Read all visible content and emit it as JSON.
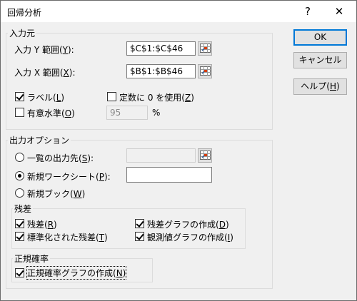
{
  "window": {
    "title": "回帰分析",
    "help_glyph": "?",
    "close_glyph": "✕"
  },
  "input_group": {
    "label": "入力元",
    "y_range_label_prefix": "入力 Y 範囲(",
    "y_range_key": "Y",
    "y_range_label_suffix": "):",
    "y_range_value": "$C$1:$C$46",
    "x_range_label_prefix": "入力 X 範囲(",
    "x_range_key": "X",
    "x_range_label_suffix": "):",
    "x_range_value": "$B$1:$B$46",
    "labels_prefix": "ラベル(",
    "labels_key": "L",
    "labels_suffix": ")",
    "labels_checked": true,
    "const_zero_prefix": "定数に 0 を使用(",
    "const_zero_key": "Z",
    "const_zero_suffix": ")",
    "const_zero_checked": false,
    "confidence_prefix": "有意水準(",
    "confidence_key": "O",
    "confidence_suffix": ")",
    "confidence_checked": false,
    "confidence_value": "95",
    "percent": "%"
  },
  "output_group": {
    "label": "出力オプション",
    "output_range_prefix": "一覧の出力先(",
    "output_range_key": "S",
    "output_range_suffix": "):",
    "output_range_value": "",
    "new_sheet_prefix": "新規ワークシート(",
    "new_sheet_key": "P",
    "new_sheet_suffix": "):",
    "new_sheet_value": "",
    "new_book_prefix": "新規ブック(",
    "new_book_key": "W",
    "new_book_suffix": ")",
    "selected": "new_sheet"
  },
  "residuals_group": {
    "label": "残差",
    "residuals_prefix": "残差(",
    "residuals_key": "R",
    "residuals_suffix": ")",
    "residuals_checked": true,
    "std_residuals_prefix": "標準化された残差(",
    "std_residuals_key": "T",
    "std_residuals_suffix": ")",
    "std_residuals_checked": true,
    "residual_plots_prefix": "残差グラフの作成(",
    "residual_plots_key": "D",
    "residual_plots_suffix": ")",
    "residual_plots_checked": true,
    "line_fit_prefix": "観測値グラフの作成(",
    "line_fit_key": "I",
    "line_fit_suffix": ")",
    "line_fit_checked": true
  },
  "normal_group": {
    "label": "正規確率",
    "normal_plot_prefix": "正規確率グラフの作成(",
    "normal_plot_key": "N",
    "normal_plot_suffix": ")",
    "normal_plot_checked": true
  },
  "buttons": {
    "ok": "OK",
    "cancel": "キャンセル",
    "help_prefix": "ヘルプ(",
    "help_key": "H",
    "help_suffix": ")"
  },
  "colors": {
    "dialog_bg": "#f0f0f0",
    "default_button_border": "#0078d7",
    "button_bg": "#e1e1e1"
  },
  "icons": {
    "range_picker": "range-picker-icon",
    "close": "close-icon",
    "help": "help-icon"
  }
}
